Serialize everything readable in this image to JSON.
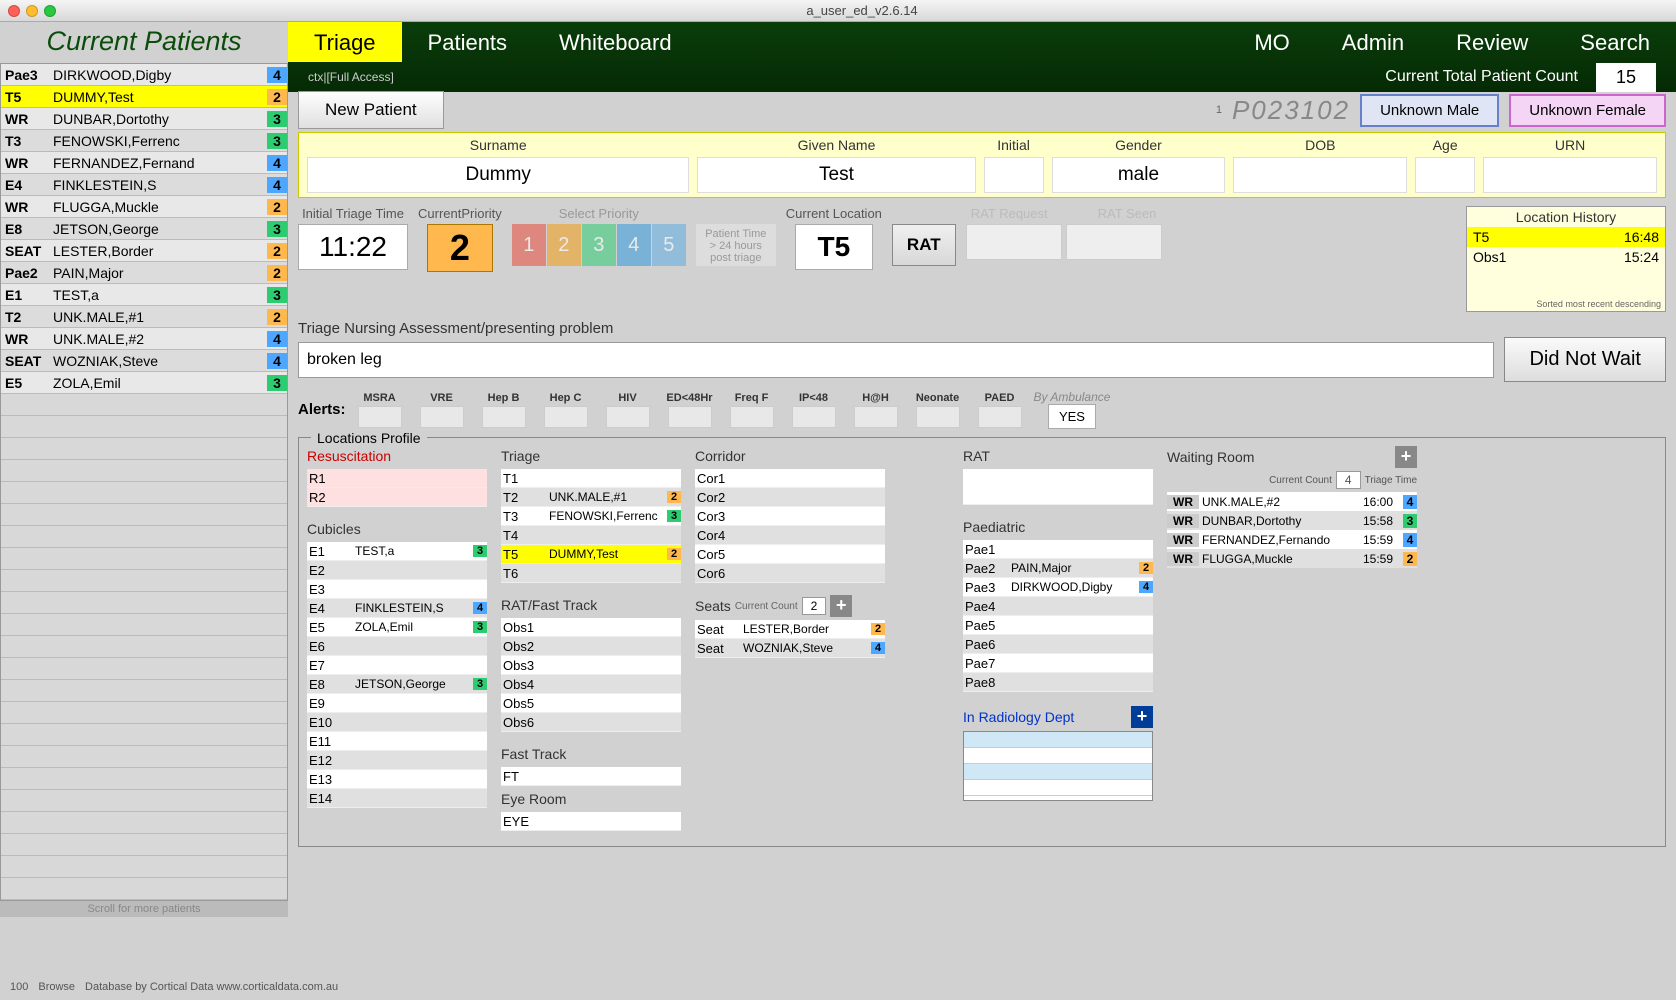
{
  "window_title": "a_user_ed_v2.6.14",
  "sidebar": {
    "title": "Current Patients",
    "scroll_hint": "Scroll for more patients",
    "patients": [
      {
        "loc": "Pae3",
        "name": "DIRKWOOD,Digby",
        "pri": 4
      },
      {
        "loc": "T5",
        "name": "DUMMY,Test",
        "pri": 2,
        "sel": true
      },
      {
        "loc": "WR",
        "name": "DUNBAR,Dortothy",
        "pri": 3
      },
      {
        "loc": "T3",
        "name": "FENOWSKI,Ferrenc",
        "pri": 3
      },
      {
        "loc": "WR",
        "name": "FERNANDEZ,Fernand",
        "pri": 4
      },
      {
        "loc": "E4",
        "name": "FINKLESTEIN,S",
        "pri": 4
      },
      {
        "loc": "WR",
        "name": "FLUGGA,Muckle",
        "pri": 2
      },
      {
        "loc": "E8",
        "name": "JETSON,George",
        "pri": 3
      },
      {
        "loc": "SEAT",
        "name": "LESTER,Border",
        "pri": 2
      },
      {
        "loc": "Pae2",
        "name": "PAIN,Major",
        "pri": 2
      },
      {
        "loc": "E1",
        "name": "TEST,a",
        "pri": 3
      },
      {
        "loc": "T2",
        "name": "UNK.MALE,#1",
        "pri": 2
      },
      {
        "loc": "WR",
        "name": "UNK.MALE,#2",
        "pri": 4
      },
      {
        "loc": "SEAT",
        "name": "WOZNIAK,Steve",
        "pri": 4
      },
      {
        "loc": "E5",
        "name": "ZOLA,Emil",
        "pri": 3
      }
    ]
  },
  "nav": {
    "tabs": [
      "Triage",
      "Patients",
      "Whiteboard"
    ],
    "right_tabs": [
      "MO",
      "Admin",
      "Review",
      "Search"
    ],
    "ctx": "ctx|[Full Access]",
    "count_label": "Current Total Patient Count",
    "count": "15"
  },
  "toolbar": {
    "new_patient": "New Patient",
    "sub": "1",
    "pid": "P023102",
    "unk_male": "Unknown Male",
    "unk_female": "Unknown Female"
  },
  "demog": {
    "labels": {
      "surname": "Surname",
      "given": "Given Name",
      "initial": "Initial",
      "gender": "Gender",
      "dob": "DOB",
      "age": "Age",
      "urn": "URN"
    },
    "values": {
      "surname": "Dummy",
      "given": "Test",
      "initial": "",
      "gender": "male",
      "dob": "",
      "age": "",
      "urn": ""
    }
  },
  "triage": {
    "itt_label": "Initial Triage Time",
    "itt": "11:22",
    "cp_label": "CurrentPriority",
    "cp": "2",
    "sp_label": "Select Priority",
    "pt_text": "Patient Time > 24 hours post triage",
    "cl_label": "Current Location",
    "cl": "T5",
    "rat": "RAT",
    "rat_req": "RAT Request",
    "rat_seen": "RAT Seen",
    "lh_title": "Location History",
    "lh": [
      {
        "loc": "T5",
        "time": "16:48",
        "hl": true
      },
      {
        "loc": "Obs1",
        "time": "15:24"
      }
    ],
    "lh_foot": "Sorted most recent descending"
  },
  "nursing": {
    "label": "Triage Nursing Assessment/presenting problem",
    "text": "broken leg",
    "dnw": "Did Not Wait"
  },
  "alerts": {
    "label": "Alerts:",
    "cols": [
      "MSRA",
      "VRE",
      "Hep B",
      "Hep C",
      "HIV",
      "ED<48Hr",
      "Freq F",
      "IP<48",
      "H@H",
      "Neonate",
      "PAED"
    ],
    "amb_label": "By Ambulance",
    "amb": "YES"
  },
  "locprof": {
    "title": "Locations Profile",
    "resusc": {
      "title": "Resuscitation",
      "rows": [
        "R1",
        "R2"
      ]
    },
    "cubicles": {
      "title": "Cubicles",
      "rows": [
        {
          "c": "E1",
          "n": "TEST,a",
          "p": 3
        },
        {
          "c": "E2"
        },
        {
          "c": "E3"
        },
        {
          "c": "E4",
          "n": "FINKLESTEIN,S",
          "p": 4
        },
        {
          "c": "E5",
          "n": "ZOLA,Emil",
          "p": 3
        },
        {
          "c": "E6"
        },
        {
          "c": "E7"
        },
        {
          "c": "E8",
          "n": "JETSON,George",
          "p": 3
        },
        {
          "c": "E9"
        },
        {
          "c": "E10"
        },
        {
          "c": "E11"
        },
        {
          "c": "E12"
        },
        {
          "c": "E13"
        },
        {
          "c": "E14"
        }
      ]
    },
    "triageloc": {
      "title": "Triage",
      "rows": [
        {
          "c": "T1"
        },
        {
          "c": "T2",
          "n": "UNK.MALE,#1",
          "p": 2
        },
        {
          "c": "T3",
          "n": "FENOWSKI,Ferrenc",
          "p": 3
        },
        {
          "c": "T4"
        },
        {
          "c": "T5",
          "n": "DUMMY,Test",
          "p": 2,
          "hl": true
        },
        {
          "c": "T6"
        }
      ]
    },
    "ratft": {
      "title": "RAT/Fast Track",
      "rows": [
        "Obs1",
        "Obs2",
        "Obs3",
        "Obs4",
        "Obs5",
        "Obs6"
      ]
    },
    "ft": {
      "title": "Fast Track",
      "row": "FT"
    },
    "eye": {
      "title": "Eye Room",
      "row": "EYE"
    },
    "corridor": {
      "title": "Corridor",
      "rows": [
        "Cor1",
        "Cor2",
        "Cor3",
        "Cor4",
        "Cor5",
        "Cor6"
      ]
    },
    "seats": {
      "title": "Seats",
      "cc_label": "Current Count",
      "cc": "2",
      "rows": [
        {
          "c": "Seat",
          "n": "LESTER,Border",
          "p": 2
        },
        {
          "c": "Seat",
          "n": "WOZNIAK,Steve",
          "p": 4
        }
      ]
    },
    "rat": {
      "title": "RAT"
    },
    "paed": {
      "title": "Paediatric",
      "rows": [
        {
          "c": "Pae1"
        },
        {
          "c": "Pae2",
          "n": "PAIN,Major",
          "p": 2
        },
        {
          "c": "Pae3",
          "n": "DIRKWOOD,Digby",
          "p": 4
        },
        {
          "c": "Pae4"
        },
        {
          "c": "Pae5"
        },
        {
          "c": "Pae6"
        },
        {
          "c": "Pae7"
        },
        {
          "c": "Pae8"
        }
      ]
    },
    "radiology": {
      "title": "In Radiology Dept"
    },
    "waiting": {
      "title": "Waiting Room",
      "cc_label": "Current Count",
      "cc": "4",
      "tt_label": "Triage Time",
      "rows": [
        {
          "n": "UNK.MALE,#2",
          "t": "16:00",
          "p": 4
        },
        {
          "n": "DUNBAR,Dortothy",
          "t": "15:58",
          "p": 3
        },
        {
          "n": "FERNANDEZ,Fernando",
          "t": "15:59",
          "p": 4
        },
        {
          "n": "FLUGGA,Muckle",
          "t": "15:59",
          "p": 2
        }
      ]
    }
  },
  "footer": {
    "credit": "Database by Cortical Data  www.corticaldata.com.au",
    "zoom": "100",
    "mode": "Browse"
  }
}
